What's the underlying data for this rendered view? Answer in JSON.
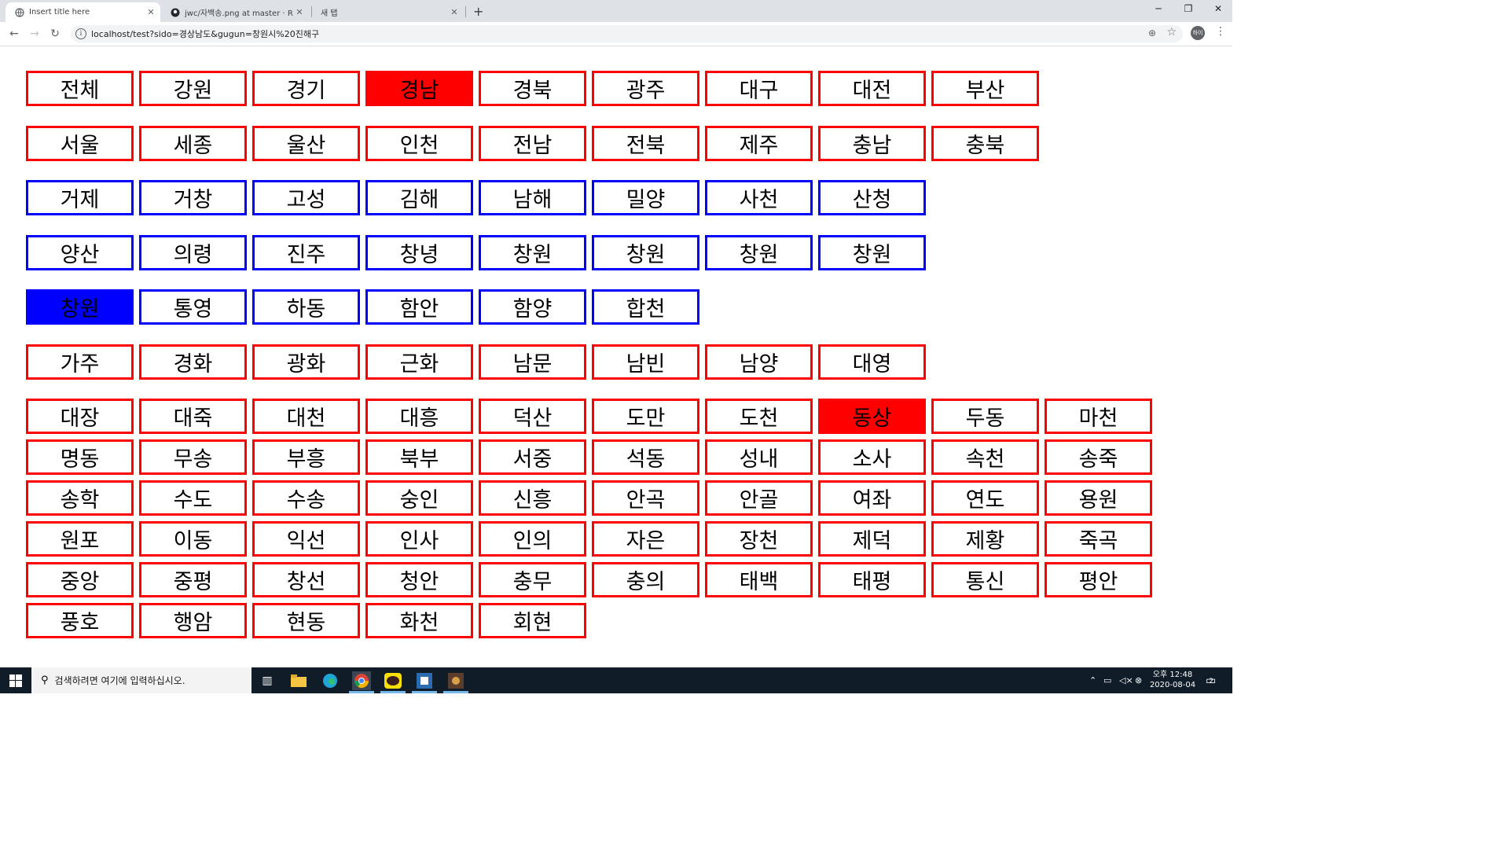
{
  "browser": {
    "tabs": [
      {
        "title": "Insert title here",
        "active": true
      },
      {
        "title": "jwc/자백송.png at master · Rion",
        "active": false
      },
      {
        "title": "새 탭",
        "active": false
      }
    ],
    "url": "localhost/test?sido=경상남도&gugun=창원시%20진해구",
    "profile_initials": "하이"
  },
  "sido_buttons": [
    {
      "label": "전체",
      "selected": false
    },
    {
      "label": "강원",
      "selected": false
    },
    {
      "label": "경기",
      "selected": false
    },
    {
      "label": "경남",
      "selected": true
    },
    {
      "label": "경북",
      "selected": false
    },
    {
      "label": "광주",
      "selected": false
    },
    {
      "label": "대구",
      "selected": false
    },
    {
      "label": "대전",
      "selected": false
    },
    {
      "label": "부산",
      "selected": false
    },
    {
      "label": "서울",
      "selected": false
    },
    {
      "label": "세종",
      "selected": false
    },
    {
      "label": "울산",
      "selected": false
    },
    {
      "label": "인천",
      "selected": false
    },
    {
      "label": "전남",
      "selected": false
    },
    {
      "label": "전북",
      "selected": false
    },
    {
      "label": "제주",
      "selected": false
    },
    {
      "label": "충남",
      "selected": false
    },
    {
      "label": "충북",
      "selected": false
    }
  ],
  "gugun_buttons": [
    {
      "label": "거제",
      "selected": false
    },
    {
      "label": "거창",
      "selected": false
    },
    {
      "label": "고성",
      "selected": false
    },
    {
      "label": "김해",
      "selected": false
    },
    {
      "label": "남해",
      "selected": false
    },
    {
      "label": "밀양",
      "selected": false
    },
    {
      "label": "사천",
      "selected": false
    },
    {
      "label": "산청",
      "selected": false
    },
    {
      "label": "양산",
      "selected": false
    },
    {
      "label": "의령",
      "selected": false
    },
    {
      "label": "진주",
      "selected": false
    },
    {
      "label": "창녕",
      "selected": false
    },
    {
      "label": "창원",
      "selected": false
    },
    {
      "label": "창원",
      "selected": false
    },
    {
      "label": "창원",
      "selected": false
    },
    {
      "label": "창원",
      "selected": false
    },
    {
      "label": "창원",
      "selected": true
    },
    {
      "label": "통영",
      "selected": false
    },
    {
      "label": "하동",
      "selected": false
    },
    {
      "label": "함안",
      "selected": false
    },
    {
      "label": "함양",
      "selected": false
    },
    {
      "label": "합천",
      "selected": false
    }
  ],
  "dong_buttons": [
    {
      "label": "가주",
      "selected": false
    },
    {
      "label": "경화",
      "selected": false
    },
    {
      "label": "광화",
      "selected": false
    },
    {
      "label": "근화",
      "selected": false
    },
    {
      "label": "남문",
      "selected": false
    },
    {
      "label": "남빈",
      "selected": false
    },
    {
      "label": "남양",
      "selected": false
    },
    {
      "label": "대영",
      "selected": false
    },
    {
      "label": "대장",
      "selected": false
    },
    {
      "label": "대죽",
      "selected": false
    },
    {
      "label": "대천",
      "selected": false
    },
    {
      "label": "대흥",
      "selected": false
    },
    {
      "label": "덕산",
      "selected": false
    },
    {
      "label": "도만",
      "selected": false
    },
    {
      "label": "도천",
      "selected": false
    },
    {
      "label": "동상",
      "selected": true
    },
    {
      "label": "두동",
      "selected": false
    },
    {
      "label": "마천",
      "selected": false
    },
    {
      "label": "명동",
      "selected": false
    },
    {
      "label": "무송",
      "selected": false
    },
    {
      "label": "부흥",
      "selected": false
    },
    {
      "label": "북부",
      "selected": false
    },
    {
      "label": "서중",
      "selected": false
    },
    {
      "label": "석동",
      "selected": false
    },
    {
      "label": "성내",
      "selected": false
    },
    {
      "label": "소사",
      "selected": false
    },
    {
      "label": "속천",
      "selected": false
    },
    {
      "label": "송죽",
      "selected": false
    },
    {
      "label": "송학",
      "selected": false
    },
    {
      "label": "수도",
      "selected": false
    },
    {
      "label": "수송",
      "selected": false
    },
    {
      "label": "숭인",
      "selected": false
    },
    {
      "label": "신흥",
      "selected": false
    },
    {
      "label": "안곡",
      "selected": false
    },
    {
      "label": "안골",
      "selected": false
    },
    {
      "label": "여좌",
      "selected": false
    },
    {
      "label": "연도",
      "selected": false
    },
    {
      "label": "용원",
      "selected": false
    },
    {
      "label": "원포",
      "selected": false
    },
    {
      "label": "이동",
      "selected": false
    },
    {
      "label": "익선",
      "selected": false
    },
    {
      "label": "인사",
      "selected": false
    },
    {
      "label": "인의",
      "selected": false
    },
    {
      "label": "자은",
      "selected": false
    },
    {
      "label": "장천",
      "selected": false
    },
    {
      "label": "제덕",
      "selected": false
    },
    {
      "label": "제황",
      "selected": false
    },
    {
      "label": "죽곡",
      "selected": false
    },
    {
      "label": "중앙",
      "selected": false
    },
    {
      "label": "중평",
      "selected": false
    },
    {
      "label": "창선",
      "selected": false
    },
    {
      "label": "청안",
      "selected": false
    },
    {
      "label": "충무",
      "selected": false
    },
    {
      "label": "충의",
      "selected": false
    },
    {
      "label": "태백",
      "selected": false
    },
    {
      "label": "태평",
      "selected": false
    },
    {
      "label": "통신",
      "selected": false
    },
    {
      "label": "평안",
      "selected": false
    },
    {
      "label": "풍호",
      "selected": false
    },
    {
      "label": "행암",
      "selected": false
    },
    {
      "label": "현동",
      "selected": false
    },
    {
      "label": "화천",
      "selected": false
    },
    {
      "label": "회현",
      "selected": false
    }
  ],
  "colors": {
    "sido_border": "#ff0000",
    "gugun_border": "#0000ff",
    "dong_border": "#ff0000",
    "sido_selected_bg": "#ff0000",
    "gugun_selected_bg": "#0000ff",
    "dong_selected_bg": "#ff0000"
  },
  "taskbar": {
    "search_placeholder": "검색하려면 여기에 입력하십시오.",
    "clock_time": "오후 12:48",
    "clock_date": "2020-08-04",
    "notification_count": "2"
  }
}
